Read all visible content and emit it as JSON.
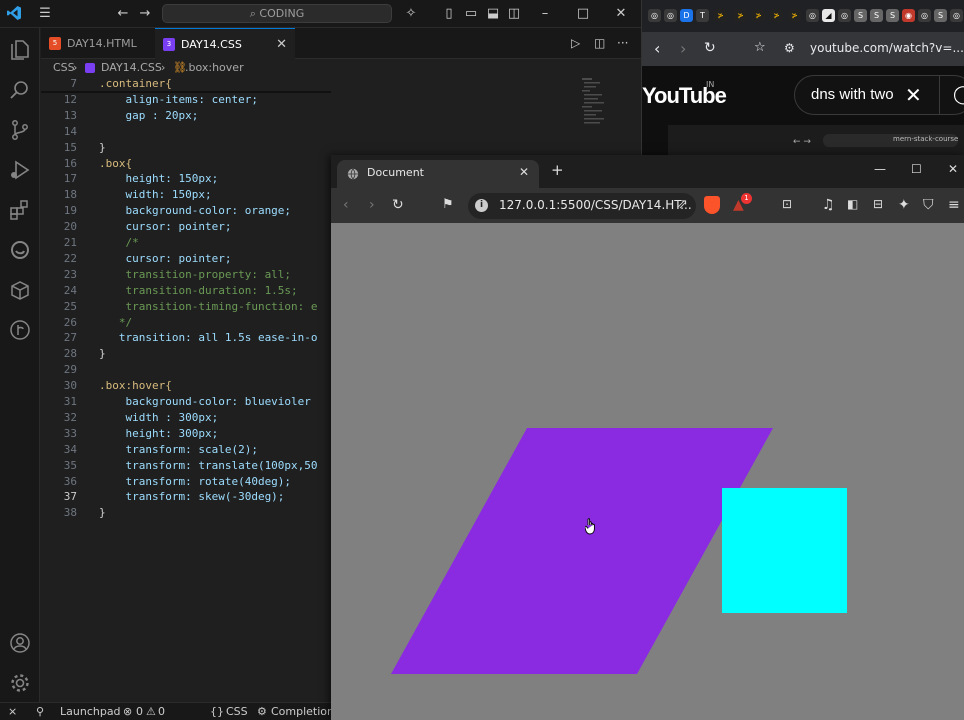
{
  "vscode": {
    "command_center": "CODING",
    "tabs": [
      {
        "label": "DAY14.HTML",
        "active": false,
        "icon": "html5-icon"
      },
      {
        "label": "DAY14.CSS",
        "active": true,
        "icon": "css3-icon"
      }
    ],
    "breadcrumb": {
      "folder": "CSS",
      "file": "DAY14.CSS",
      "symbol": ".box:hover"
    },
    "code_lines": [
      {
        "n": "7",
        "text": ".container{"
      },
      {
        "n": "12",
        "text": "    align-items: center;"
      },
      {
        "n": "13",
        "text": "    gap : 20px;"
      },
      {
        "n": "14",
        "text": ""
      },
      {
        "n": "15",
        "text": "}"
      },
      {
        "n": "16",
        "text": ".box{"
      },
      {
        "n": "17",
        "text": "    height: 150px;"
      },
      {
        "n": "18",
        "text": "    width: 150px;"
      },
      {
        "n": "19",
        "text": "    background-color: orange;"
      },
      {
        "n": "20",
        "text": "    cursor: pointer;"
      },
      {
        "n": "21",
        "text": "    /*"
      },
      {
        "n": "22",
        "text": "    cursor: pointer;"
      },
      {
        "n": "23",
        "text": "    transition-property: all;"
      },
      {
        "n": "24",
        "text": "    transition-duration: 1.5s;"
      },
      {
        "n": "25",
        "text": "    transition-timing-function: e"
      },
      {
        "n": "26",
        "text": "   */"
      },
      {
        "n": "27",
        "text": "   transition: all 1.5s ease-in-o"
      },
      {
        "n": "28",
        "text": "}"
      },
      {
        "n": "29",
        "text": ""
      },
      {
        "n": "30",
        "text": ".box:hover{"
      },
      {
        "n": "31",
        "text": "    background-color: bluevioler"
      },
      {
        "n": "32",
        "text": "    width : 300px;"
      },
      {
        "n": "33",
        "text": "    height: 300px;"
      },
      {
        "n": "34",
        "text": "    transform: scale(2);"
      },
      {
        "n": "35",
        "text": "    transform: translate(100px,50"
      },
      {
        "n": "36",
        "text": "    transform: rotate(40deg);"
      },
      {
        "n": "37",
        "text": "    transform: skew(-30deg);"
      },
      {
        "n": "38",
        "text": "}"
      }
    ],
    "status": {
      "remote": "⨯",
      "launchpad": "Launchpad",
      "errors": "0",
      "warnings": "0",
      "language": "CSS",
      "completions": "Completions"
    }
  },
  "youtube_window": {
    "url": "youtube.com/watch?v=...",
    "logo": "YouTube",
    "region": "IN",
    "search_query": "dns with two",
    "thumbnail_caption": "mern-stack-course"
  },
  "browser": {
    "tab_title": "Document",
    "url": "127.0.0.1:5500/CSS/DAY14.HT...",
    "brave_badge": "1",
    "page_colors": {
      "background": "#808080",
      "hover_box": "#8a2be2",
      "cyan_box": "#00ffff"
    }
  }
}
